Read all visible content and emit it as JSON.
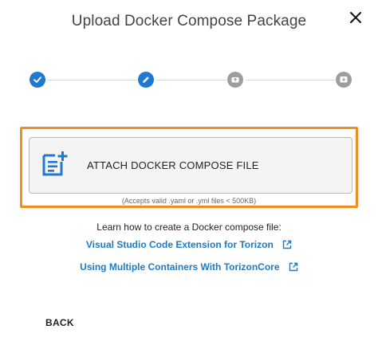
{
  "dialog": {
    "title": "Upload Docker Compose Package",
    "close_icon": "close-icon"
  },
  "stepper": {
    "steps": [
      {
        "state": "complete",
        "icon": "check-icon",
        "color": "#1f78d1"
      },
      {
        "state": "active",
        "icon": "pencil-icon",
        "color": "#1f78d1"
      },
      {
        "state": "pending",
        "icon": "upload-box-icon",
        "color": "#9e9e9e"
      },
      {
        "state": "pending",
        "icon": "download-box-icon",
        "color": "#9e9e9e"
      }
    ]
  },
  "attach": {
    "label": "ATTACH DOCKER COMPOSE FILE",
    "icon": "note-add-icon",
    "hint": "(Accepts valid .yaml or .yml files < 500KB)",
    "highlight_color": "#f28c1f"
  },
  "learn": {
    "text": "Learn how to create a Docker compose file:",
    "links": [
      {
        "label": "Visual Studio Code Extension for Torizon",
        "icon": "external-link-icon"
      },
      {
        "label": "Using Multiple Containers With TorizonCore",
        "icon": "external-link-icon"
      }
    ],
    "link_color": "#1c7bc4"
  },
  "footer": {
    "back_label": "BACK"
  }
}
